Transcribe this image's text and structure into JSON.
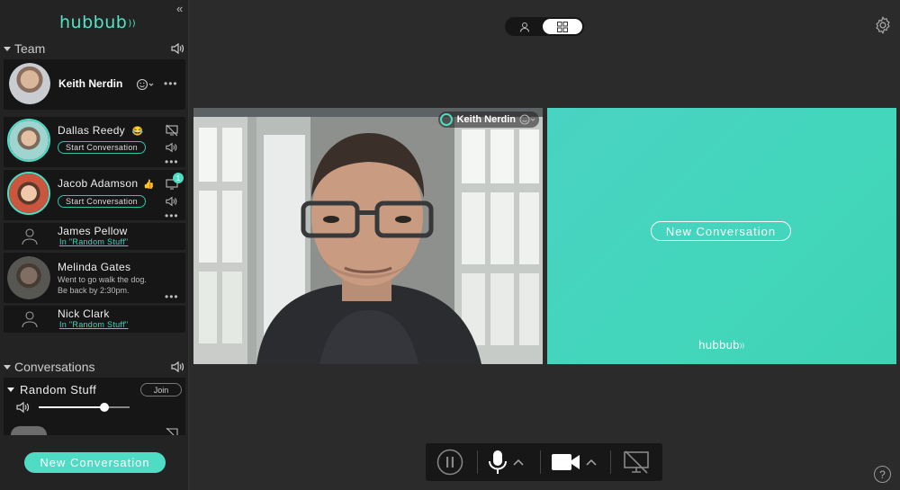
{
  "app": {
    "logo": "hubbub"
  },
  "sidebar": {
    "team_header": "Team",
    "conversations_header": "Conversations",
    "self": {
      "name": "Keith Nerdin"
    },
    "members": [
      {
        "name": "Dallas Reedy",
        "emoji": "😂",
        "action": "Start Conversation"
      },
      {
        "name": "Jacob Adamson",
        "emoji": "👍",
        "action": "Start Conversation",
        "badge": "1"
      },
      {
        "name": "James Pellow",
        "link": "In \"Random Stuff\""
      },
      {
        "name": "Melinda Gates",
        "status_line1": "Went to go walk the dog.",
        "status_line2": "Be back by 2:30pm."
      },
      {
        "name": "Nick Clark",
        "link": "In \"Random Stuff\""
      }
    ],
    "conversation": {
      "name": "Random Stuff",
      "join_label": "Join",
      "volume": 0.72
    },
    "new_conversation_label": "New Conversation"
  },
  "main": {
    "video_tile": {
      "name": "Keith Nerdin"
    },
    "new_tile": {
      "label": "New Conversation",
      "logo": "hubbub"
    },
    "help_label": "?"
  },
  "colors": {
    "accent": "#4fdcc4",
    "background": "#2b2b2b",
    "sidebar": "#232323",
    "card": "#161616"
  }
}
